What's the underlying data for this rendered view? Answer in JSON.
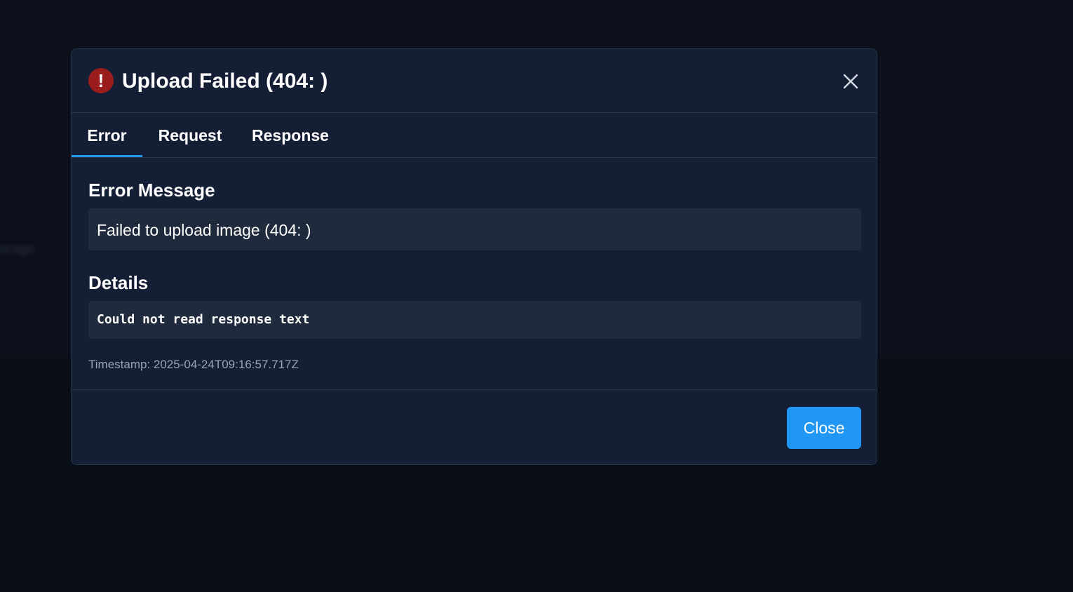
{
  "backdrop": {
    "blurred_text": "lorage"
  },
  "dialog": {
    "icon": "error-exclamation-icon",
    "icon_glyph": "!",
    "title": "Upload Failed (404: )",
    "close_icon": "close-icon"
  },
  "tabs": [
    {
      "label": "Error",
      "active": true
    },
    {
      "label": "Request",
      "active": false
    },
    {
      "label": "Response",
      "active": false
    }
  ],
  "error_panel": {
    "message_heading": "Error Message",
    "message": "Failed to upload image (404: )",
    "details_heading": "Details",
    "details": "Could not read response text",
    "timestamp": "Timestamp: 2025-04-24T09:16:57.717Z"
  },
  "footer": {
    "close_label": "Close"
  },
  "colors": {
    "accent": "#2196f3",
    "error": "#9b1c1c",
    "surface": "#141e34",
    "panel": "#1f2a3c"
  }
}
